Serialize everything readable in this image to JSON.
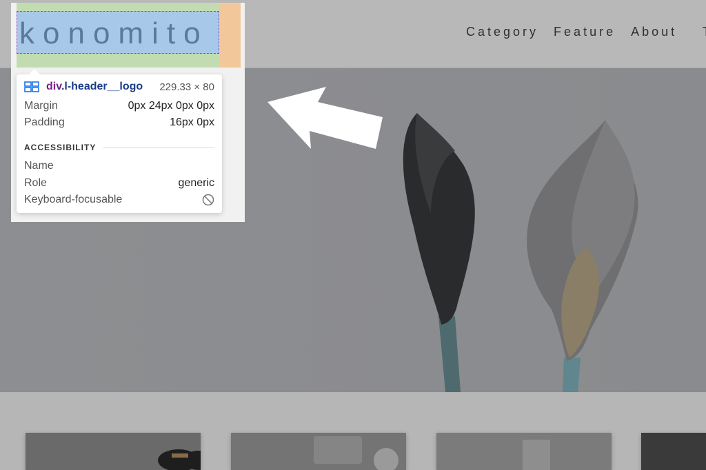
{
  "header": {
    "logo": "konomito",
    "nav": [
      "Category",
      "Feature",
      "About"
    ],
    "nav_cut": "T"
  },
  "inspector": {
    "selector_tag": "div",
    "selector_class": ".l-header__logo",
    "dimensions": "229.33 × 80",
    "margin_label": "Margin",
    "margin_value": "0px 24px 0px 0px",
    "padding_label": "Padding",
    "padding_value": "16px 0px",
    "section_title": "ACCESSIBILITY",
    "name_label": "Name",
    "name_value": "",
    "role_label": "Role",
    "role_value": "generic",
    "focusable_label": "Keyboard-focusable"
  },
  "colors": {
    "content_highlight": "#a8c8ea",
    "padding_highlight": "#c3dbb0",
    "margin_highlight": "#f2c89a",
    "selector_tag": "#7b1d89",
    "selector_class": "#1b3c8a"
  }
}
